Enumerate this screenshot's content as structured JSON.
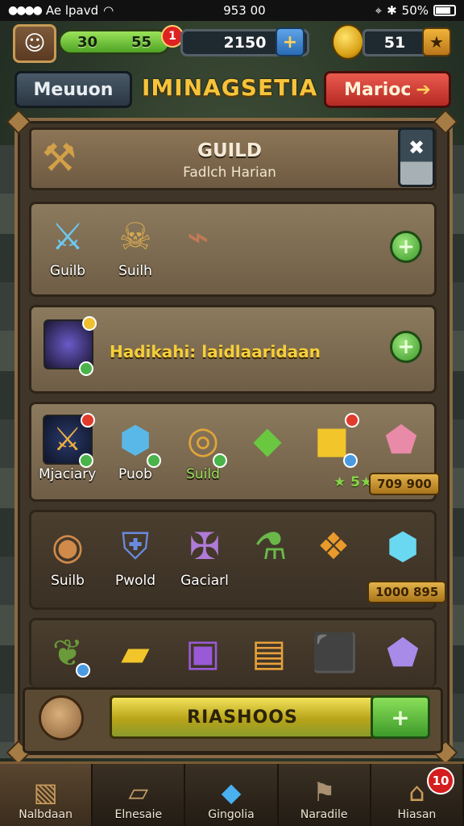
{
  "status_bar": {
    "carrier": "Ae lpavd",
    "time": "953 00",
    "battery": "50%"
  },
  "resources": {
    "xp_left": "30",
    "xp_right": "55",
    "xp_badge": "1",
    "gold": "2150",
    "gems": "51"
  },
  "header": {
    "left_button": "Meuuon",
    "title": "IMINAGSETIA",
    "right_button": "Marioc"
  },
  "guild": {
    "title": "GUILD",
    "subtitle": "Fadlch Harian"
  },
  "row1": {
    "items": [
      {
        "label": "Guilb",
        "icon": "crystal-sword-icon"
      },
      {
        "label": "Suilh",
        "icon": "crossed-swords-icon"
      },
      {
        "label": "",
        "icon": "bronze-blade-icon"
      }
    ]
  },
  "row2": {
    "text": "Hadikahi: laidlaaridaan",
    "icon": "magic-staff-icon"
  },
  "row3": {
    "items": [
      {
        "label": "Mjaciary",
        "icon": "golden-sword-icon"
      },
      {
        "label": "Puob",
        "icon": "blue-gem-amulet-icon"
      },
      {
        "label": "Suild",
        "icon": "gold-ring-icon"
      },
      {
        "label": "",
        "icon": "green-crystal-icon"
      },
      {
        "label": "",
        "icon": "gold-cube-icon"
      },
      {
        "label": "",
        "icon": "pink-gem-icon"
      }
    ],
    "stars": "★ 5★",
    "price": "709 900"
  },
  "row4": {
    "items": [
      {
        "label": "Suilb",
        "icon": "bronze-eye-icon"
      },
      {
        "label": "Pwold",
        "icon": "blue-shield-icon"
      },
      {
        "label": "Gaciarl",
        "icon": "purple-crossbones-icon"
      },
      {
        "label": "",
        "icon": "green-potion-icon"
      },
      {
        "label": "",
        "icon": "orange-relic-icon"
      },
      {
        "label": "",
        "icon": "cyan-gem-icon"
      }
    ],
    "price": "1000 895"
  },
  "row5": {
    "items": [
      {
        "icon": "green-relic-icon"
      },
      {
        "icon": "gold-bar-icon"
      },
      {
        "icon": "purple-chest-icon"
      },
      {
        "icon": "gold-scroll-icon"
      },
      {
        "icon": "blue-cube-icon"
      },
      {
        "icon": "violet-gem-icon"
      }
    ]
  },
  "action": {
    "main_button": "RIASHOOS",
    "plus": "+"
  },
  "nav": [
    {
      "label": "Nalbdaan",
      "icon": "crate-icon"
    },
    {
      "label": "Elnesaie",
      "icon": "scroll-icon"
    },
    {
      "label": "Gingolia",
      "icon": "blue-crystal-icon"
    },
    {
      "label": "Naradile",
      "icon": "banner-icon"
    },
    {
      "label": "Hiasan",
      "icon": "house-icon",
      "badge": "10"
    }
  ]
}
